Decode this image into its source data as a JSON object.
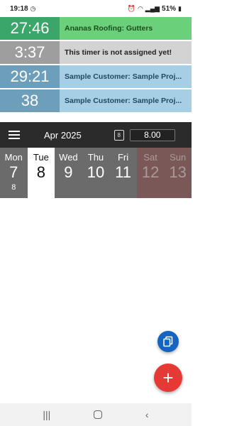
{
  "status_bar": {
    "time": "19:18",
    "battery": "51%"
  },
  "timers": [
    {
      "clock": "27:46",
      "label": "Ananas Roofing: Gutters",
      "clock_color": "#3aa66a",
      "label_bg": "#6bd07a",
      "label_color": "#1d4d1d"
    },
    {
      "clock": "3:37",
      "label": "This timer is not assigned yet!",
      "clock_color": "#9e9e9e",
      "label_bg": "#d3d3d3",
      "label_color": "#222222"
    },
    {
      "clock": "29:21",
      "label": "Sample Customer: Sample Proj...",
      "clock_color": "#6e9fba",
      "label_bg": "#a6cfe6",
      "label_color": "#24485c"
    },
    {
      "clock": "38",
      "label": "Sample Customer: Sample Proj...",
      "clock_color": "#6e9fba",
      "label_bg": "#a6cfe6",
      "label_color": "#24485c"
    }
  ],
  "toolbar": {
    "month": "Apr 2025",
    "calendar_icon_text": "8",
    "hours_value": "8.00"
  },
  "days": [
    {
      "name": "Mon",
      "num": "7",
      "count": "8"
    },
    {
      "name": "Tue",
      "num": "8",
      "count": ""
    },
    {
      "name": "Wed",
      "num": "9",
      "count": ""
    },
    {
      "name": "Thu",
      "num": "10",
      "count": ""
    },
    {
      "name": "Fri",
      "num": "11",
      "count": ""
    },
    {
      "name": "Sat",
      "num": "12",
      "count": ""
    },
    {
      "name": "Sun",
      "num": "13",
      "count": ""
    }
  ],
  "fab": {
    "add_symbol": "+"
  },
  "navbar": {
    "recents": "|||",
    "back": "‹"
  },
  "colors": {
    "toolbar_bg": "#2b2b2b",
    "day_bg": "#6b6b6b",
    "weekend_bg": "#7a5858",
    "fab_add": "#e53935",
    "fab_copy": "#1565c0"
  }
}
